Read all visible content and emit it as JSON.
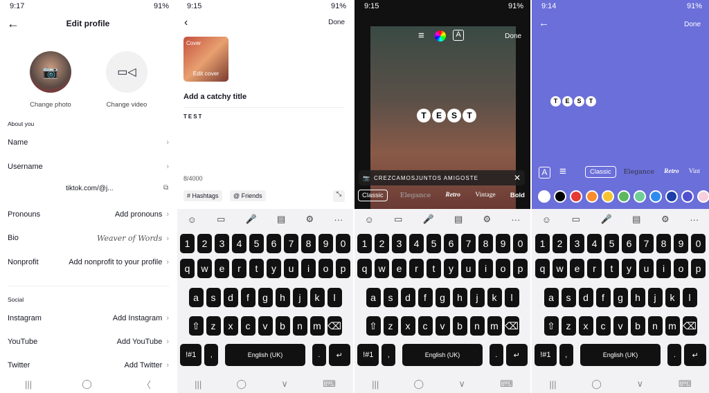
{
  "panel1": {
    "time": "9:17",
    "battery": "91%",
    "title": "Edit profile",
    "change_photo": "Change photo",
    "change_video": "Change video",
    "about": "About you",
    "rows": [
      {
        "label": "Name",
        "value": ""
      },
      {
        "label": "Username",
        "value": ""
      }
    ],
    "link": "tiktok.com/@j...",
    "rows2": [
      {
        "label": "Pronouns",
        "value": "Add pronouns"
      },
      {
        "label": "Bio",
        "value": "Weaver of Words"
      },
      {
        "label": "Nonprofit",
        "value": "Add nonprofit to your profile"
      }
    ],
    "social": "Social",
    "social_rows": [
      {
        "label": "Instagram",
        "value": "Add Instagram"
      },
      {
        "label": "YouTube",
        "value": "Add YouTube"
      },
      {
        "label": "Twitter",
        "value": "Add Twitter"
      }
    ]
  },
  "panel2": {
    "time": "9:15",
    "battery": "91%",
    "done": "Done",
    "cover": "Cover",
    "edit_cover": "Edit cover",
    "title_placeholder": "Add a catchy title",
    "text": "TEST",
    "count": "8/4000",
    "hashtags": "# Hashtags",
    "friends": "@ Friends"
  },
  "panel3": {
    "time": "9:15",
    "battery": "91%",
    "done": "Done",
    "text": "TEST",
    "suggestion": "CREZCAMOSJUNTOS AMIGOSTE",
    "fonts": [
      "Classic",
      "Elegance",
      "Retro",
      "Vintage",
      "Bold"
    ]
  },
  "panel4": {
    "time": "9:14",
    "battery": "91%",
    "done": "Done",
    "text": "TEST",
    "fonts": [
      "Classic",
      "Elegance",
      "Retro",
      "Vint"
    ],
    "bg_color": "#6b6fd9",
    "colors": [
      "#ffffff",
      "#000000",
      "#e53935",
      "#fb8c2c",
      "#f4c430",
      "#5cb85c",
      "#6fcf97",
      "#2d8cf0",
      "#1e3fa8",
      "#5050d0",
      "#f6cfdc",
      "#a08a5a"
    ]
  },
  "keyboard": {
    "tools": [
      "☺",
      "▭",
      "🎤",
      "▤",
      "⚙",
      "···"
    ],
    "rows": [
      [
        "1",
        "2",
        "3",
        "4",
        "5",
        "6",
        "7",
        "8",
        "9",
        "0"
      ],
      [
        "q",
        "w",
        "e",
        "r",
        "t",
        "y",
        "u",
        "i",
        "o",
        "p"
      ],
      [
        "a",
        "s",
        "d",
        "f",
        "g",
        "h",
        "j",
        "k",
        "l"
      ],
      [
        "⇧",
        "z",
        "x",
        "c",
        "v",
        "b",
        "n",
        "m",
        "⌫"
      ],
      [
        "!#1",
        ",",
        "English (UK)",
        ".",
        "↵"
      ]
    ],
    "nav": [
      "|||",
      "◯",
      "∨",
      "⌨"
    ]
  },
  "nav1": [
    "|||",
    "◯",
    "〈"
  ]
}
